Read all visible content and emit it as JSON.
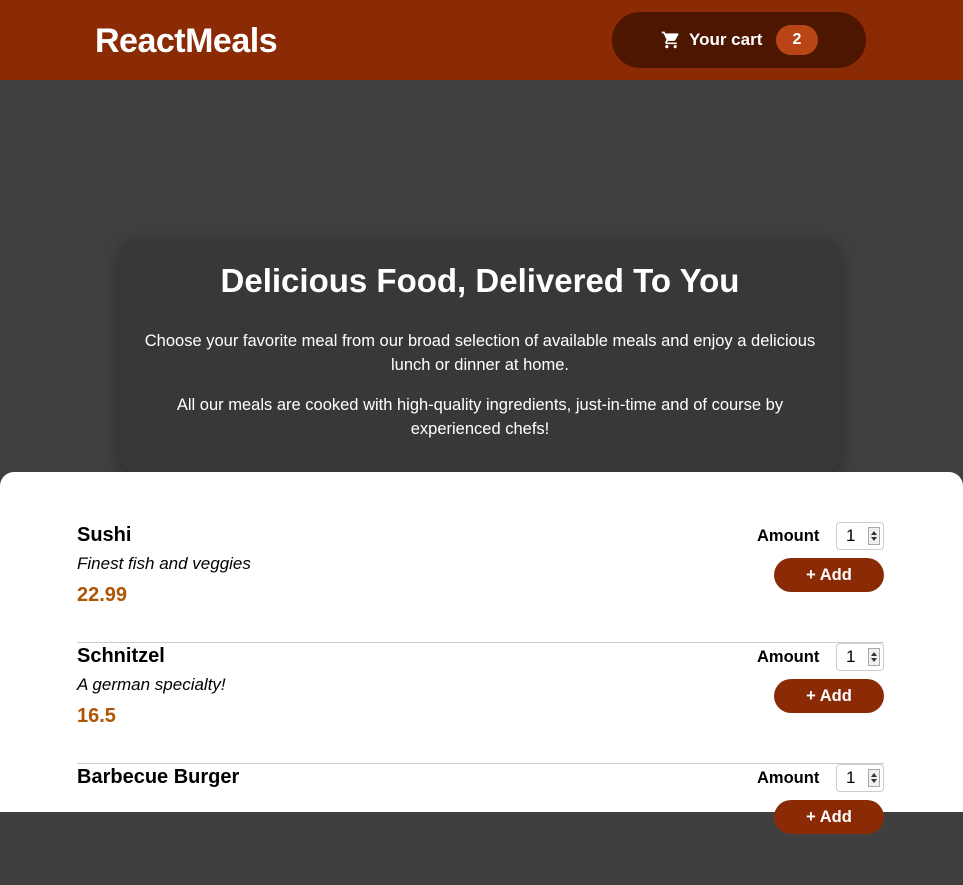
{
  "header": {
    "brand": "ReactMeals",
    "cart": {
      "icon": "cart-icon",
      "label": "Your cart",
      "count": "2"
    }
  },
  "summary": {
    "title": "Delicious Food, Delivered To You",
    "paragraph1": "Choose your favorite meal from our broad selection of available meals and enjoy a delicious lunch or dinner at home.",
    "paragraph2": "All our meals are cooked with high-quality ingredients, just-in-time and of course by experienced chefs!"
  },
  "meals": [
    {
      "name": "Sushi",
      "description": "Finest fish and veggies",
      "price": "22.99",
      "amount_label": "Amount",
      "amount_value": "1",
      "add_label": "+ Add"
    },
    {
      "name": "Schnitzel",
      "description": "A german specialty!",
      "price": "16.5",
      "amount_label": "Amount",
      "amount_value": "1",
      "add_label": "+ Add"
    },
    {
      "name": "Barbecue Burger",
      "description": "",
      "price": "",
      "amount_label": "Amount",
      "amount_value": "1",
      "add_label": "+ Add"
    }
  ],
  "colors": {
    "header_bg": "#8a2b06",
    "cart_bg": "#4d1601",
    "badge_bg": "#b94517",
    "price": "#ad5502",
    "button_bg": "#8a2b06"
  }
}
